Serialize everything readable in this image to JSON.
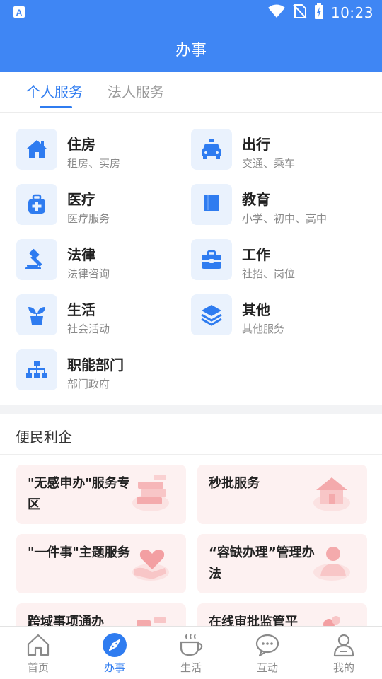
{
  "status_bar": {
    "time": "10:23",
    "app_icon": "a-icon"
  },
  "app_bar": {
    "title": "办事"
  },
  "tabs": [
    {
      "label": "个人服务",
      "active": true
    },
    {
      "label": "法人服务",
      "active": false
    }
  ],
  "services": [
    {
      "name": "住房",
      "sub": "租房、买房",
      "icon": "home-icon"
    },
    {
      "name": "出行",
      "sub": "交通、乘车",
      "icon": "car-icon"
    },
    {
      "name": "医疗",
      "sub": "医疗服务",
      "icon": "medical-kit-icon"
    },
    {
      "name": "教育",
      "sub": "小学、初中、高中",
      "icon": "book-icon"
    },
    {
      "name": "法律",
      "sub": "法律咨询",
      "icon": "gavel-icon"
    },
    {
      "name": "工作",
      "sub": "社招、岗位",
      "icon": "briefcase-icon"
    },
    {
      "name": "生活",
      "sub": "社会活动",
      "icon": "plant-icon"
    },
    {
      "name": "其他",
      "sub": "其他服务",
      "icon": "layers-icon"
    },
    {
      "name": "职能部门",
      "sub": "部门政府",
      "icon": "org-chart-icon"
    }
  ],
  "convenience": {
    "title": "便民利企",
    "cards": [
      {
        "text": "\"无感申办\"服务专区",
        "icon": "books-icon"
      },
      {
        "text": "秒批服务",
        "icon": "house-icon"
      },
      {
        "text": "\"一件事\"主题服务",
        "icon": "heart-hand-icon"
      },
      {
        "text": "“容缺办理”管理办法",
        "icon": "person-icon"
      },
      {
        "text": "跨域事项通办",
        "icon": "document-icon"
      },
      {
        "text": "在线审批监管平",
        "icon": "badge-icon"
      }
    ]
  },
  "bottom_nav": [
    {
      "label": "首页",
      "icon": "home-outline-icon",
      "active": false
    },
    {
      "label": "办事",
      "icon": "compass-icon",
      "active": true
    },
    {
      "label": "生活",
      "icon": "coffee-icon",
      "active": false
    },
    {
      "label": "互动",
      "icon": "chat-icon",
      "active": false
    },
    {
      "label": "我的",
      "icon": "user-icon",
      "active": false
    }
  ],
  "colors": {
    "primary": "#3f86f4",
    "accent": "#2f7cf0",
    "card_bg": "#fdf1f1",
    "icon_bg": "#eaf2fd"
  }
}
